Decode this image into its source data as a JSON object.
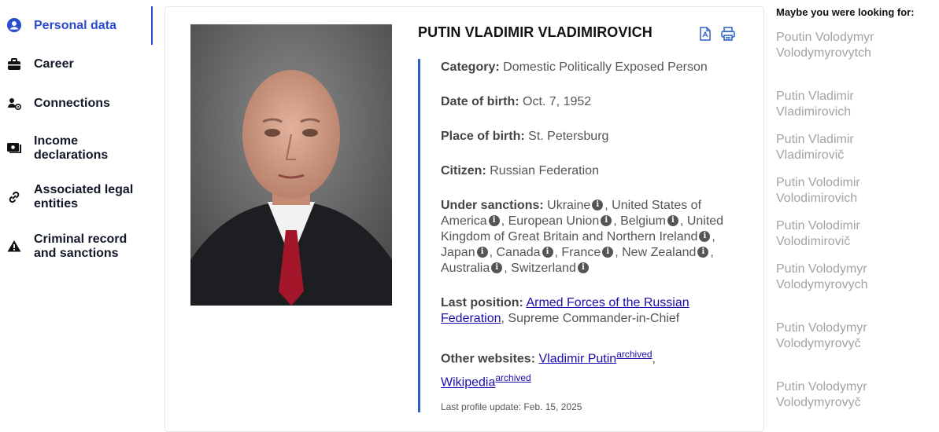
{
  "sidebar": {
    "items": [
      {
        "label": "Personal data",
        "icon": "user-circle-icon"
      },
      {
        "label": "Career",
        "icon": "briefcase-icon"
      },
      {
        "label": "Connections",
        "icon": "user-network-icon"
      },
      {
        "label": "Income declarations",
        "icon": "money-icon"
      },
      {
        "label": "Associated legal entities",
        "icon": "link-icon"
      },
      {
        "label": "Criminal record and sanctions",
        "icon": "warning-icon"
      }
    ]
  },
  "profile": {
    "name": "PUTIN VLADIMIR VLADIMIROVICH",
    "category_label": "Category:",
    "category": "Domestic Politically Exposed Person",
    "dob_label": "Date of birth:",
    "dob": "Oct. 7, 1952",
    "pob_label": "Place of birth:",
    "pob": "St. Petersburg",
    "citizen_label": "Citizen:",
    "citizen": "Russian Federation",
    "sanctions_label": "Under sanctions:",
    "sanctions": [
      "Ukraine",
      "United States of America",
      "European Union",
      "Belgium",
      "United Kingdom of Great Britain and Northern Ireland",
      "Japan",
      "Canada",
      "France",
      "New Zealand",
      "Australia",
      "Switzerland"
    ],
    "last_position_label": "Last position:",
    "last_position_link": "Armed Forces of the Russian Federation",
    "last_position_role": ", Supreme Commander-in-Chief",
    "websites_label": "Other websites:",
    "website1": "Vladimir Putin",
    "website2": "Wikipedia",
    "archived": "archived",
    "updated": "Last profile update: Feb. 15, 2025"
  },
  "suggestions": {
    "title": "Maybe you were looking for:",
    "items": [
      "Poutin Volodymyr Volodymyrovytch",
      "Putin Vladimir Vladimirovich",
      "Putin Vladimir Vladimirovič",
      "Putin Volodimir Volodimirovich",
      "Putin Volodimir Volodimirovič",
      "Putin Volodymyr Volodymyrovych",
      "Putin Volodymyr Volodymyrovyč",
      "Putin Volodymyr Volodymyrovyč"
    ]
  },
  "colors": {
    "accent": "#2b4bd1",
    "detail_border": "#2b61c9",
    "suggest": "#a3a3a3"
  }
}
